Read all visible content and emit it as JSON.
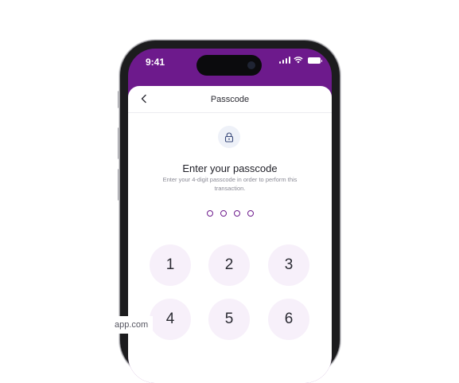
{
  "status_bar": {
    "time": "9:41"
  },
  "nav": {
    "title": "Passcode",
    "back_icon": "chevron-left-icon"
  },
  "lock_icon": "lock-icon",
  "heading": "Enter your passcode",
  "subtext": "Enter your 4-digit passcode in order to perform this transaction.",
  "passcode": {
    "length": 4,
    "filled": 0
  },
  "keypad": {
    "keys": [
      "1",
      "2",
      "3",
      "4",
      "5",
      "6"
    ]
  },
  "watermark": "app.com",
  "colors": {
    "brand": "#6d1a8c",
    "key_bg": "#f7f0fa",
    "lock_bg": "#eef1f8"
  }
}
